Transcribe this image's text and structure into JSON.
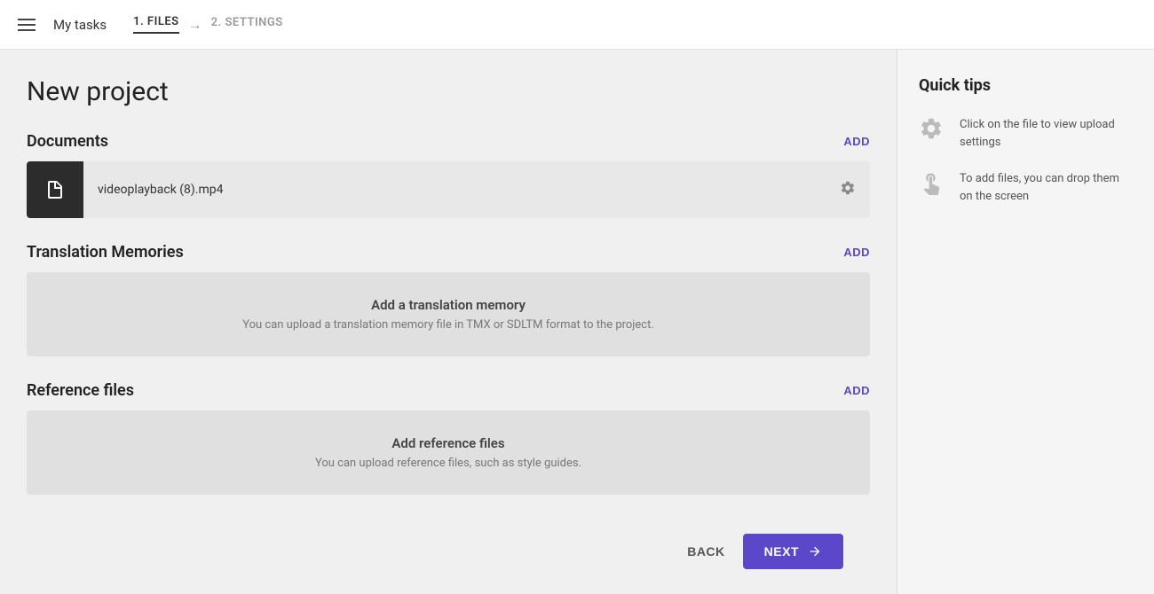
{
  "header": {
    "hamburger_label": "menu",
    "my_tasks_label": "My tasks",
    "step1_label": "1. FILES",
    "arrow": "→",
    "step2_label": "2. SETTINGS"
  },
  "main": {
    "page_title": "New project",
    "documents": {
      "section_title": "Documents",
      "add_label": "ADD",
      "file": {
        "name": "videoplayback (8).mp4"
      }
    },
    "translation_memories": {
      "section_title": "Translation Memories",
      "add_label": "ADD",
      "placeholder_title": "Add a translation memory",
      "placeholder_sub": "You can upload a translation memory file in TMX or SDLTM format to the project."
    },
    "reference_files": {
      "section_title": "Reference files",
      "add_label": "ADD",
      "placeholder_title": "Add reference files",
      "placeholder_sub": "You can upload reference files, such as style guides."
    }
  },
  "footer": {
    "back_label": "BACK",
    "next_label": "NEXT"
  },
  "sidebar": {
    "title": "Quick tips",
    "tip1": "Click on the file to view upload settings",
    "tip2": "To add files, you can drop them on the screen"
  }
}
